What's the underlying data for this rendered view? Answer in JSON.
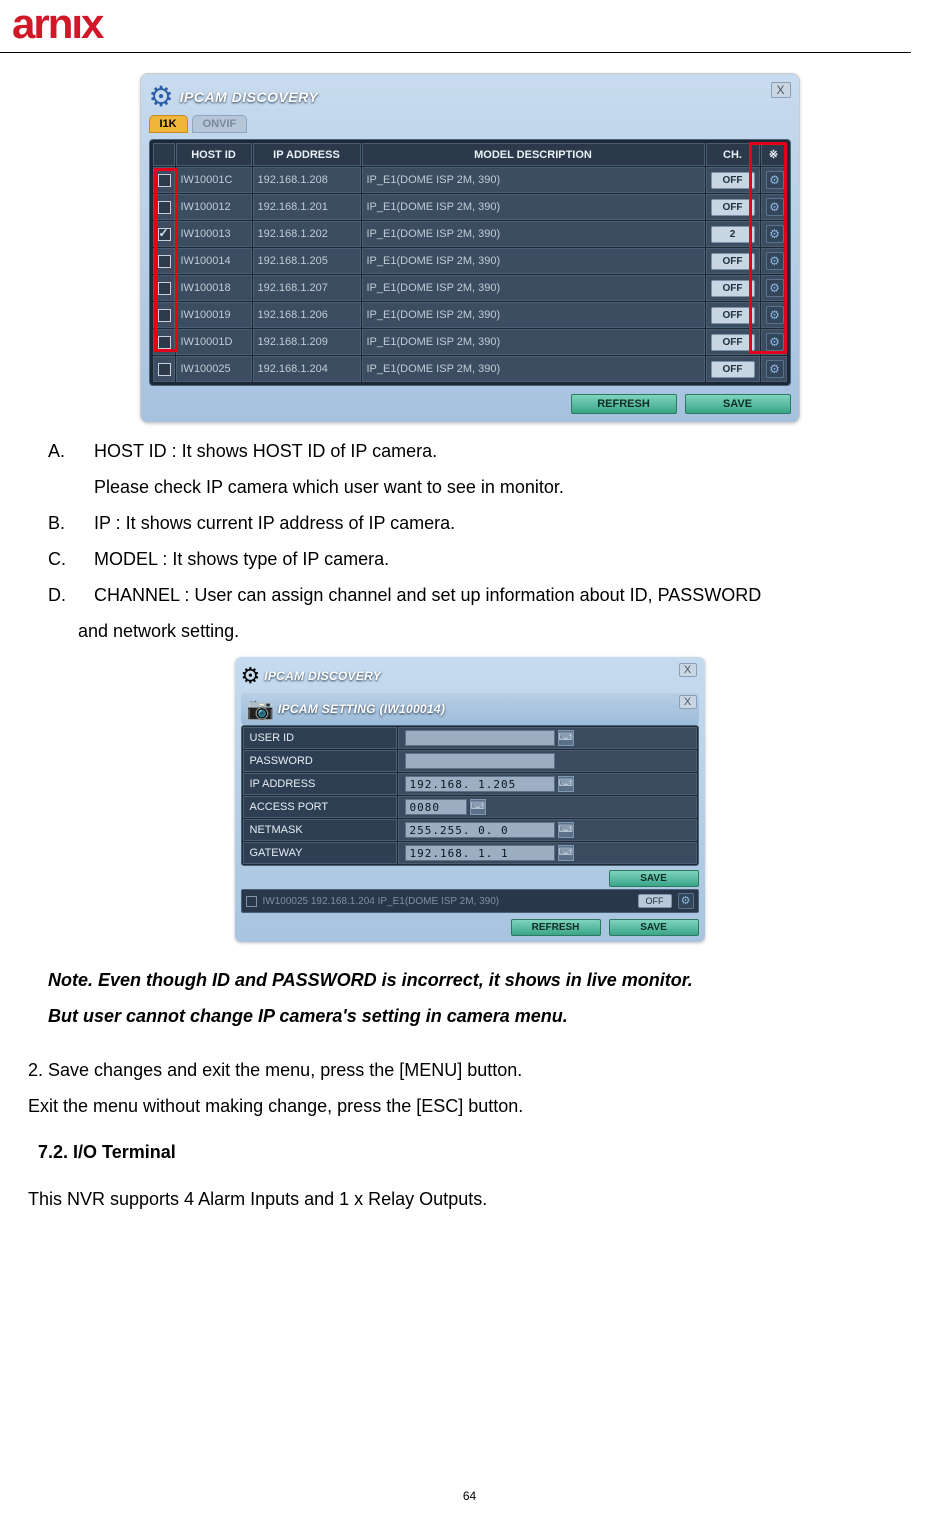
{
  "logo_text": "arnıx",
  "page_number": "64",
  "discovery_dialog": {
    "title": "IPCAM DISCOVERY",
    "tabs": {
      "i1k": "I1K",
      "onvif": "ONVIF"
    },
    "headers": {
      "host": "HOST ID",
      "ip": "IP ADDRESS",
      "model": "MODEL DESCRIPTION",
      "ch": "CH.",
      "star": "※"
    },
    "rows": [
      {
        "checked": false,
        "host": "IW10001C",
        "ip": "192.168.1.208",
        "model": "IP_E1(DOME ISP 2M, 390)",
        "ch": "OFF"
      },
      {
        "checked": false,
        "host": "IW100012",
        "ip": "192.168.1.201",
        "model": "IP_E1(DOME ISP 2M, 390)",
        "ch": "OFF"
      },
      {
        "checked": true,
        "host": "IW100013",
        "ip": "192.168.1.202",
        "model": "IP_E1(DOME ISP 2M, 390)",
        "ch": "2"
      },
      {
        "checked": false,
        "host": "IW100014",
        "ip": "192.168.1.205",
        "model": "IP_E1(DOME ISP 2M, 390)",
        "ch": "OFF"
      },
      {
        "checked": false,
        "host": "IW100018",
        "ip": "192.168.1.207",
        "model": "IP_E1(DOME ISP 2M, 390)",
        "ch": "OFF"
      },
      {
        "checked": false,
        "host": "IW100019",
        "ip": "192.168.1.206",
        "model": "IP_E1(DOME ISP 2M, 390)",
        "ch": "OFF"
      },
      {
        "checked": false,
        "host": "IW10001D",
        "ip": "192.168.1.209",
        "model": "IP_E1(DOME ISP 2M, 390)",
        "ch": "OFF"
      },
      {
        "checked": false,
        "host": "IW100025",
        "ip": "192.168.1.204",
        "model": "IP_E1(DOME ISP 2M, 390)",
        "ch": "OFF"
      }
    ],
    "refresh": "REFRESH",
    "save": "SAVE"
  },
  "paragraphs": {
    "a_pre": "A.",
    "a": "HOST ID : It shows HOST ID of IP camera.",
    "a2": "Please check IP camera which user want to see in monitor.",
    "b_pre": "B.",
    "b": "IP : It shows current IP address of IP camera.",
    "c_pre": "C.",
    "c": "MODEL : It shows type of IP camera.",
    "d_pre": "D.",
    "d": "CHANNEL : User can assign channel and set up information about ID, PASSWORD",
    "d2": "and network setting."
  },
  "setting_dialog": {
    "outer_title": "IPCAM DISCOVERY",
    "inner_title": "IPCAM SETTING (IW100014)",
    "rows": {
      "uid_label": "USER ID",
      "uid_val": "",
      "pw_label": "PASSWORD",
      "pw_val": "",
      "ip_label": "IP ADDRESS",
      "ip_val": "192.168.  1.205",
      "port_label": "ACCESS PORT",
      "port_val": "0080",
      "nm_label": "NETMASK",
      "nm_val": "255.255.  0.  0",
      "gw_label": "GATEWAY",
      "gw_val": "192.168.  1.  1"
    },
    "save": "SAVE",
    "under_row": "IW100025  192.168.1.204    IP_E1(DOME ISP 2M, 390)",
    "under_off": "OFF",
    "refresh": "REFRESH",
    "save2": "SAVE"
  },
  "note1": "Note. Even though ID and PASSWORD is incorrect, it shows in live monitor.",
  "note2": "But user cannot change IP camera's setting in camera menu.",
  "para2a": "2. Save changes and exit the menu, press the [MENU] button.",
  "para2b": "Exit the menu without making change, press the [ESC] button.",
  "section": "7.2.  I/O  Terminal",
  "para3": "This NVR supports 4 Alarm Inputs and 1 x Relay Outputs."
}
